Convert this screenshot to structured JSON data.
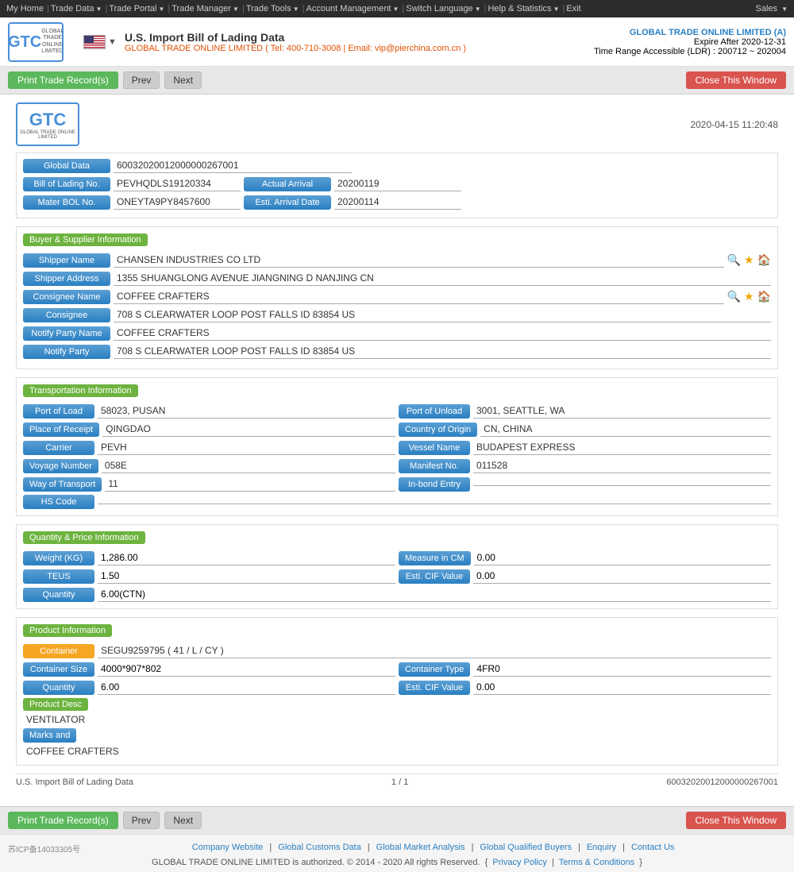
{
  "topNav": {
    "items": [
      "My Home",
      "Trade Data",
      "Trade Portal",
      "Trade Manager",
      "Trade Tools",
      "Account Management",
      "Switch Language",
      "Help & Statistics",
      "Exit"
    ],
    "sales": "Sales"
  },
  "header": {
    "logoText": "GTC",
    "logoSub": "GLOBAL TRADE\nONLINE LIMITED",
    "title": "U.S. Import Bill of Lading Data",
    "subtitle": "GLOBAL TRADE ONLINE LIMITED ( Tel: 400-710-3008 | Email: vip@pierchina.com.cn )",
    "brand": "GLOBAL TRADE ONLINE LIMITED (A)",
    "expiry": "Expire After 2020-12-31",
    "timeRange": "Time Range Accessible (LDR) : 200712 ~ 202004"
  },
  "toolbar": {
    "printLabel": "Print Trade Record(s)",
    "prevLabel": "Prev",
    "nextLabel": "Next",
    "closeLabel": "Close This Window"
  },
  "record": {
    "datetime": "2020-04-15 11:20:48",
    "globalData": "60032020012000000267001",
    "billOfLadingNo": "PEVHQDLS19120334",
    "actualArrival": "20200119",
    "materBOLNo": "ONEYTA9PY8457600",
    "estiArrivalDate": "20200114"
  },
  "buyerSupplier": {
    "sectionTitle": "Buyer & Supplier Information",
    "shipperName": "CHANSEN INDUSTRIES CO LTD",
    "shipperAddress": "1355 SHUANGLONG AVENUE JIANGNING D NANJING CN",
    "consigneeName": "COFFEE CRAFTERS",
    "consignee": "708 S CLEARWATER LOOP POST FALLS ID 83854 US",
    "notifyPartyName": "COFFEE CRAFTERS",
    "notifyParty": "708 S CLEARWATER LOOP POST FALLS ID 83854 US"
  },
  "transportation": {
    "sectionTitle": "Transportation Information",
    "portOfLoad": "58023, PUSAN",
    "portOfUnload": "3001, SEATTLE, WA",
    "placeOfReceipt": "QINGDAO",
    "countryOfOrigin": "CN, CHINA",
    "carrier": "PEVH",
    "vesselName": "BUDAPEST EXPRESS",
    "voyageNumber": "058E",
    "manifestNo": "011528",
    "wayOfTransport": "11",
    "inBondEntry": "",
    "hsCode": ""
  },
  "quantity": {
    "sectionTitle": "Quantity & Price Information",
    "weightKG": "1,286.00",
    "measureInCM": "0.00",
    "teus": "1.50",
    "estiCIFValue": "0.00",
    "quantity": "6.00(CTN)"
  },
  "product": {
    "sectionTitle": "Product Information",
    "container": "SEGU9259795 ( 41 / L / CY )",
    "containerSize": "4000*907*802",
    "containerType": "4FR0",
    "quantity": "6.00",
    "estiCIFValue": "0.00",
    "productDesc": "VENTILATOR",
    "marksAndNumbers": "COFFEE CRAFTERS"
  },
  "recordFooter": {
    "label": "U.S. Import Bill of Lading Data",
    "page": "1 / 1",
    "id": "60032020012000000267001"
  },
  "footer": {
    "icp": "苏ICP备14033305号",
    "links": [
      "Company Website",
      "Global Customs Data",
      "Global Market Analysis",
      "Global Qualified Buyers",
      "Enquiry",
      "Contact Us"
    ],
    "copyright": "GLOBAL TRADE ONLINE LIMITED is authorized. © 2014 - 2020 All rights Reserved.",
    "privacyPolicy": "Privacy Policy",
    "termsConditions": "Terms & Conditions"
  },
  "labels": {
    "globalData": "Global Data",
    "billOfLadingNo": "Bill of Lading No.",
    "actualArrival": "Actual Arrival",
    "materBOLNo": "Mater BOL No.",
    "estiArrivalDate": "Esti. Arrival Date",
    "shipperName": "Shipper Name",
    "shipperAddress": "Shipper Address",
    "consigneeName": "Consignee Name",
    "consignee": "Consignee",
    "notifyPartyName": "Notify Party Name",
    "notifyParty": "Notify Party",
    "portOfLoad": "Port of Load",
    "portOfUnload": "Port of Unload",
    "placeOfReceipt": "Place of Receipt",
    "countryOfOrigin": "Country of Origin",
    "carrier": "Carrier",
    "vesselName": "Vessel Name",
    "voyageNumber": "Voyage Number",
    "manifestNo": "Manifest No.",
    "wayOfTransport": "Way of Transport",
    "inBondEntry": "In-bond Entry",
    "hsCode": "HS Code",
    "weightKG": "Weight (KG)",
    "measureInCM": "Measure in CM",
    "teus": "TEUS",
    "estiCIFValue": "Esti. CIF Value",
    "quantity": "Quantity",
    "container": "Container",
    "containerSize": "Container Size",
    "containerType": "Container Type",
    "productDesc": "Product Desc",
    "marksAnd": "Marks and"
  }
}
